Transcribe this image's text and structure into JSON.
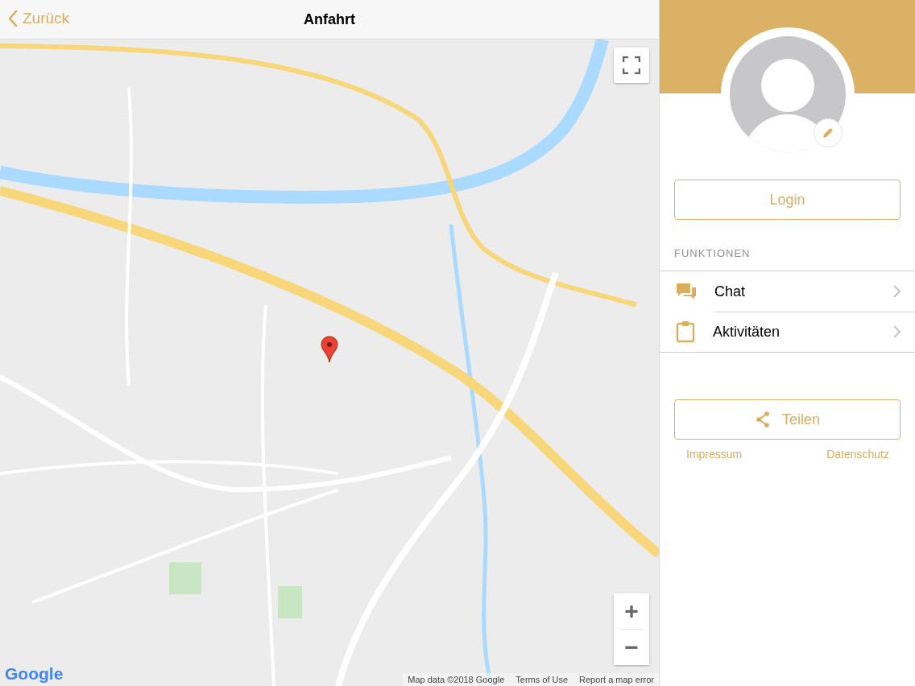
{
  "nav": {
    "back": "Zurück",
    "title": "Anfahrt"
  },
  "map": {
    "logo": "Google",
    "attribution": "Map data ©2018 Google",
    "terms": "Terms of Use",
    "report": "Report a map error",
    "zoom_in": "+",
    "zoom_out": "−"
  },
  "sidebar": {
    "login": "Login",
    "section": "FUNKTIONEN",
    "items": [
      {
        "label": "Chat"
      },
      {
        "label": "Aktivitäten"
      }
    ],
    "share": "Teilen",
    "links": [
      "Impressum",
      "Datenschutz"
    ]
  }
}
